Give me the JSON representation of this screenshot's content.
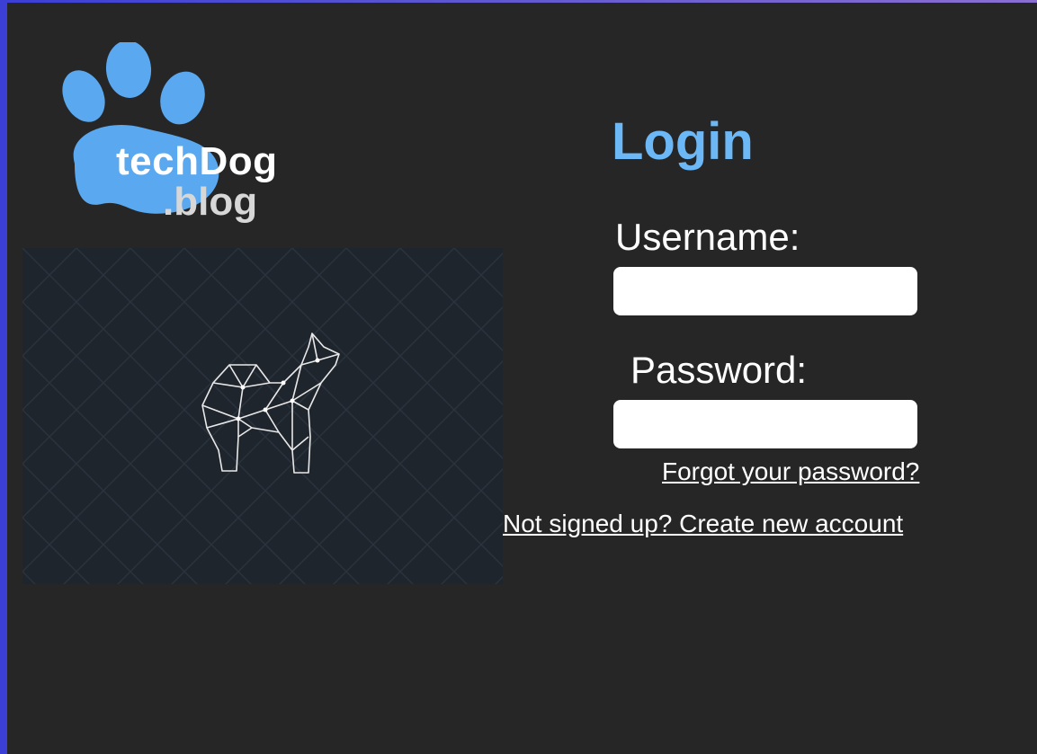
{
  "brand": {
    "name_main": "techDog",
    "name_sub": ".blog",
    "logo_color": "#5aa8f0",
    "logo_icon": "paw-icon"
  },
  "hero": {
    "image": "geometric-dog-illustration",
    "background_color": "#1f252d"
  },
  "login": {
    "title": "Login",
    "title_color": "#6cb7f5",
    "username_label": "Username:",
    "username_value": "",
    "password_label": "Password:",
    "password_value": "",
    "forgot_link": "Forgot your password?",
    "signup_link": "Not signed up? Create new account"
  }
}
